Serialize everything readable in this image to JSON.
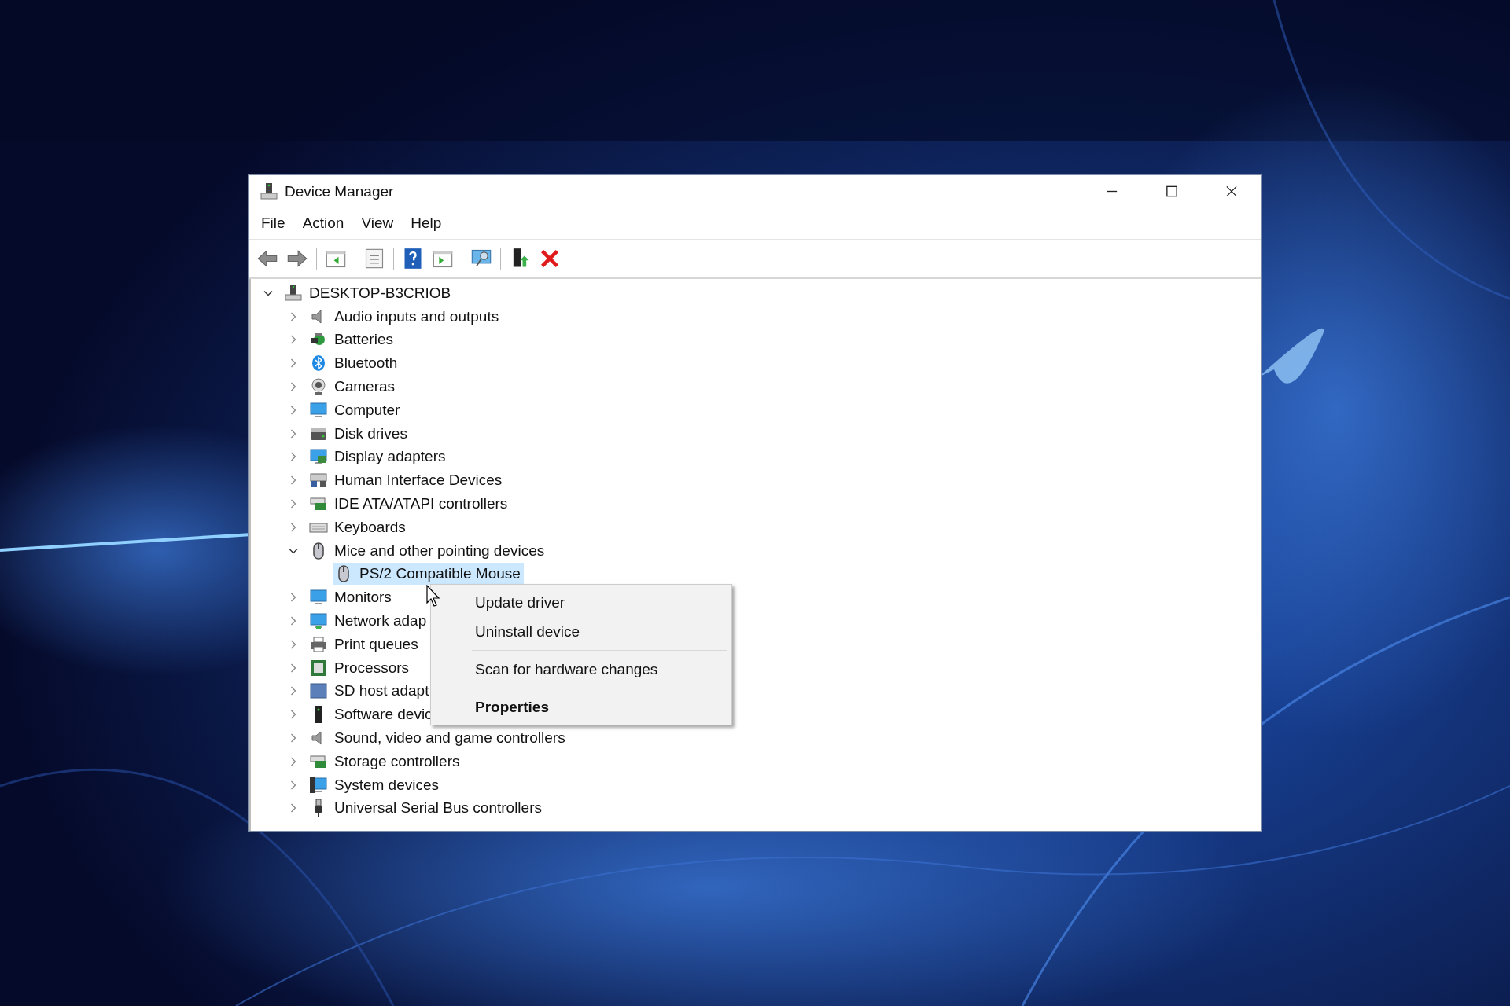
{
  "window": {
    "title": "Device Manager"
  },
  "menu_bar": [
    "File",
    "Action",
    "View",
    "Help"
  ],
  "tree": {
    "label": "DESKTOP-B3CRIOB",
    "expanded": true,
    "selected": false,
    "children": [
      {
        "label": "Audio inputs and outputs",
        "expanded": false,
        "selected": false
      },
      {
        "label": "Batteries",
        "expanded": false,
        "selected": false
      },
      {
        "label": "Bluetooth",
        "expanded": false,
        "selected": false
      },
      {
        "label": "Cameras",
        "expanded": false,
        "selected": false
      },
      {
        "label": "Computer",
        "expanded": false,
        "selected": false
      },
      {
        "label": "Disk drives",
        "expanded": false,
        "selected": false
      },
      {
        "label": "Display adapters",
        "expanded": false,
        "selected": false
      },
      {
        "label": "Human Interface Devices",
        "expanded": false,
        "selected": false
      },
      {
        "label": "IDE ATA/ATAPI controllers",
        "expanded": false,
        "selected": false
      },
      {
        "label": "Keyboards",
        "expanded": false,
        "selected": false
      },
      {
        "label": "Mice and other pointing devices",
        "expanded": true,
        "selected": false,
        "children": [
          {
            "label": "PS/2 Compatible Mouse",
            "selected": true
          }
        ]
      },
      {
        "label": "Monitors",
        "expanded": false,
        "selected": false
      },
      {
        "label": "Network adap",
        "expanded": false,
        "selected": false
      },
      {
        "label": "Print queues",
        "expanded": false,
        "selected": false
      },
      {
        "label": "Processors",
        "expanded": false,
        "selected": false
      },
      {
        "label": "SD host adapt",
        "expanded": false,
        "selected": false
      },
      {
        "label": "Software devic",
        "expanded": false,
        "selected": false
      },
      {
        "label": "Sound, video and game controllers",
        "expanded": false,
        "selected": false
      },
      {
        "label": "Storage controllers",
        "expanded": false,
        "selected": false
      },
      {
        "label": "System devices",
        "expanded": false,
        "selected": false
      },
      {
        "label": "Universal Serial Bus controllers",
        "expanded": false,
        "selected": false
      }
    ]
  },
  "context_menu": [
    {
      "kind": "item",
      "label": "Update driver",
      "default": false
    },
    {
      "kind": "item",
      "label": "Uninstall device",
      "default": false
    },
    {
      "kind": "separator"
    },
    {
      "kind": "item",
      "label": "Scan for hardware changes",
      "default": false
    },
    {
      "kind": "separator"
    },
    {
      "kind": "item",
      "label": "Properties",
      "default": true
    }
  ]
}
